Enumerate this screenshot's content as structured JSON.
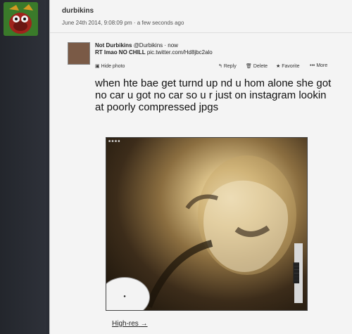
{
  "post": {
    "author": "durbikins",
    "meta": "June 24th 2014, 9:08:09 pm · a few seconds ago"
  },
  "tweet": {
    "name": "Not Durbikins",
    "handle": "@Durbikins",
    "time": "now",
    "rt_prefix": "RT",
    "rt_text": "lmao NO CHILL",
    "rt_link": "pic.twitter.com/Hd8jbc2alo",
    "hide_photo": "Hide photo",
    "actions": {
      "reply": "Reply",
      "delete": "Delete",
      "favorite": "Favorite",
      "more": "More"
    },
    "text": "when hte bae get turnd up nd u hom alone she got no car u got no car so u r just on instagram lookin at poorly compressed jpgs"
  },
  "high_res": "High-res"
}
